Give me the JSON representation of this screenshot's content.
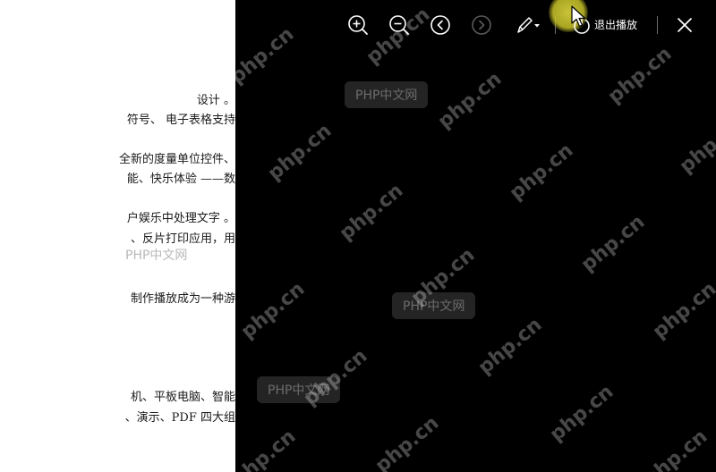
{
  "document": {
    "lines": [
      "设计 。",
      "符号、 电子表格支持",
      "全新的度量单位控件、",
      "能、快乐体验 ——数",
      "户娱乐中处理文字 。",
      "、反片打印应用，用",
      "制作播放成为一种游",
      "机、平板电脑、智能",
      "、演示、PDF 四大组"
    ]
  },
  "watermarks": {
    "diagonal": "php.cn",
    "boxed": "PHP中文网"
  },
  "toolbar": {
    "zoom_in_icon": "zoom-in-icon",
    "zoom_out_icon": "zoom-out-icon",
    "prev_icon": "chevron-left-icon",
    "next_icon": "chevron-right-icon",
    "pen_icon": "pen-icon",
    "exit_icon": "power-icon",
    "exit_label": "退出播放",
    "close_icon": "close-icon"
  },
  "colors": {
    "slide_background": "#000000",
    "page_background": "#ffffff",
    "laser_pointer": "#d4ce3c"
  }
}
